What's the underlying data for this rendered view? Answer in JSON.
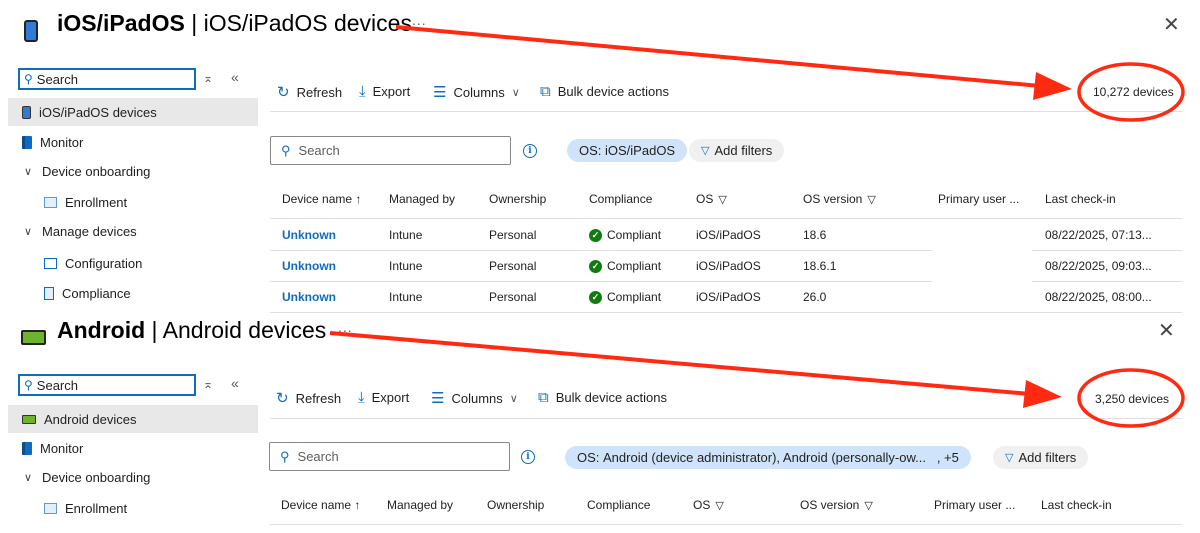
{
  "panels": [
    {
      "title_bold": "iOS/iPadOS",
      "title_rest": " | iOS/iPadOS devices",
      "ellipsis": "...",
      "search_placeholder": "Search",
      "collapse_label": "«",
      "expand_label": "✕",
      "nav": [
        {
          "label": "iOS/iPadOS devices"
        },
        {
          "label": "Monitor"
        },
        {
          "label": "Device onboarding"
        },
        {
          "label": "Enrollment"
        },
        {
          "label": "Manage devices"
        },
        {
          "label": "Configuration"
        },
        {
          "label": "Compliance"
        }
      ],
      "toolbar": {
        "refresh": "Refresh",
        "export": "Export",
        "columns": "Columns",
        "bulk": "Bulk device actions"
      },
      "device_count": "10,272 devices",
      "filter_chip": {
        "label": "OS: ",
        "value": "iOS/iPadOS"
      },
      "add_filters": "Add filters",
      "columns": [
        "Device name ↑",
        "Managed by",
        "Ownership",
        "Compliance",
        "OS",
        "OS version",
        "Primary user ...",
        "Last check-in"
      ],
      "rows": [
        {
          "name": "Unknown",
          "managed": "Intune",
          "ownership": "Personal",
          "compliance": "Compliant",
          "os": "iOS/iPadOS",
          "version": "18.6",
          "user": "",
          "checkin": "08/22/2025, 07:13..."
        },
        {
          "name": "Unknown",
          "managed": "Intune",
          "ownership": "Personal",
          "compliance": "Compliant",
          "os": "iOS/iPadOS",
          "version": "18.6.1",
          "user": "",
          "checkin": "08/22/2025, 09:03..."
        },
        {
          "name": "Unknown",
          "managed": "Intune",
          "ownership": "Personal",
          "compliance": "Compliant",
          "os": "iOS/iPadOS",
          "version": "26.0",
          "user": "",
          "checkin": "08/22/2025, 08:00..."
        }
      ]
    },
    {
      "title_bold": "Android",
      "title_rest": " | Android devices",
      "ellipsis": "...",
      "search_placeholder": "Search",
      "collapse_label": "«",
      "expand_label": "✕",
      "nav": [
        {
          "label": "Android devices"
        },
        {
          "label": "Monitor"
        },
        {
          "label": "Device onboarding"
        },
        {
          "label": "Enrollment"
        }
      ],
      "toolbar": {
        "refresh": "Refresh",
        "export": "Export",
        "columns": "Columns",
        "bulk": "Bulk device actions"
      },
      "device_count": "3,250 devices",
      "filter_chip": {
        "label": "OS: ",
        "value": "Android (device administrator), Android (personally-ow...   , +5"
      },
      "add_filters": "Add filters",
      "columns": [
        "Device name ↑",
        "Managed by",
        "Ownership",
        "Compliance",
        "OS",
        "OS version",
        "Primary user ...",
        "Last check-in"
      ]
    }
  ],
  "colors": {
    "accent": "#0f6cbd",
    "annotation": "#ff2a10",
    "selected": "#e8e8e8",
    "chip": "#cfe4fa",
    "compliant": "#107c10"
  }
}
